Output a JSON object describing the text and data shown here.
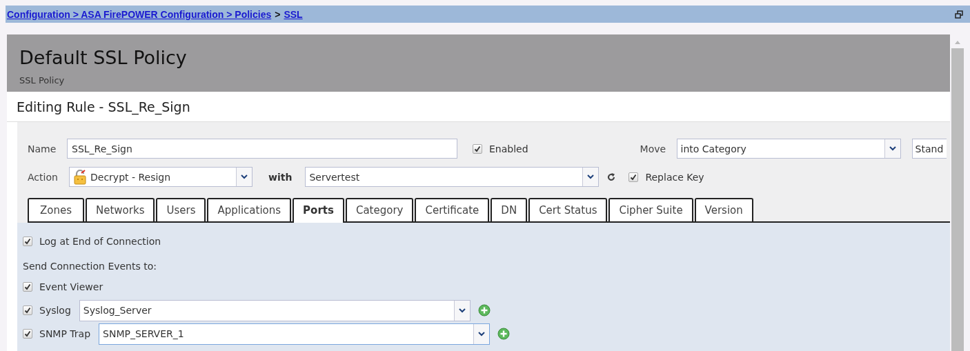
{
  "breadcrumb": [
    {
      "kind": "link",
      "label": "Configuration > ASA FirePOWER Configuration > Policies"
    },
    {
      "kind": "separator",
      "label": ">"
    },
    {
      "kind": "link",
      "label": "SSL"
    }
  ],
  "policy": {
    "title": "Default SSL Policy",
    "subtitle": "SSL Policy"
  },
  "editor": {
    "title": "Editing Rule - SSL_Re_Sign"
  },
  "form": {
    "name_label": "Name",
    "name_value": "SSL_Re_Sign",
    "enabled": {
      "label": "Enabled",
      "checked": true
    },
    "move_label": "Move",
    "move_value": "into Category",
    "move_extra": "Stand",
    "action_label": "Action",
    "action_value": "Decrypt - Resign",
    "with_label": "with",
    "with_value": "Servertest",
    "replace_key": {
      "label": "Replace Key",
      "checked": true
    }
  },
  "tabs": [
    {
      "label": "Zones",
      "selected": false
    },
    {
      "label": "Networks",
      "selected": false
    },
    {
      "label": "Users",
      "selected": false
    },
    {
      "label": "Applications",
      "selected": false
    },
    {
      "label": "Ports",
      "selected": true
    },
    {
      "label": "Category",
      "selected": false
    },
    {
      "label": "Certificate",
      "selected": false
    },
    {
      "label": "DN",
      "selected": false
    },
    {
      "label": "Cert Status",
      "selected": false
    },
    {
      "label": "Cipher Suite",
      "selected": false
    },
    {
      "label": "Version",
      "selected": false
    }
  ],
  "logging": {
    "log_end": {
      "label": "Log at End of Connection",
      "checked": true
    },
    "send_heading": "Send Connection Events to:",
    "targets": [
      {
        "kind": "plain",
        "label": "Event Viewer",
        "checked": true
      },
      {
        "kind": "select",
        "label": "Syslog",
        "checked": true,
        "value": "Syslog_Server",
        "focused": false
      },
      {
        "kind": "select",
        "label": "SNMP Trap",
        "checked": true,
        "value": "SNMP_SERVER_1",
        "focused": true
      }
    ]
  }
}
